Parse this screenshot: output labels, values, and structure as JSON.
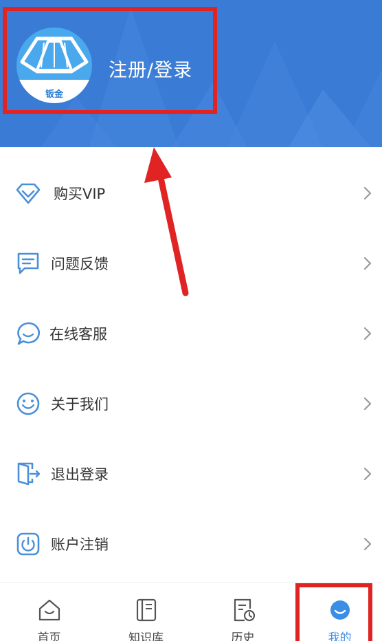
{
  "header": {
    "avatar_text": "钣金",
    "login_label": "注册/登录"
  },
  "menu": {
    "items": [
      {
        "label": "购买VIP",
        "icon": "diamond-icon"
      },
      {
        "label": "问题反馈",
        "icon": "feedback-icon"
      },
      {
        "label": "在线客服",
        "icon": "chat-icon"
      },
      {
        "label": "关于我们",
        "icon": "smile-icon"
      },
      {
        "label": "退出登录",
        "icon": "logout-icon"
      },
      {
        "label": "账户注销",
        "icon": "power-icon"
      }
    ]
  },
  "bottom_nav": {
    "items": [
      {
        "label": "首页",
        "icon": "home-icon",
        "active": false
      },
      {
        "label": "知识库",
        "icon": "book-icon",
        "active": false
      },
      {
        "label": "历史",
        "icon": "history-icon",
        "active": false
      },
      {
        "label": "我的",
        "icon": "profile-icon",
        "active": true
      }
    ]
  },
  "colors": {
    "header_bg": "#3a7bd5",
    "accent": "#3a8ee6",
    "highlight_red": "#e02424",
    "icon_blue": "#4a90d9"
  }
}
